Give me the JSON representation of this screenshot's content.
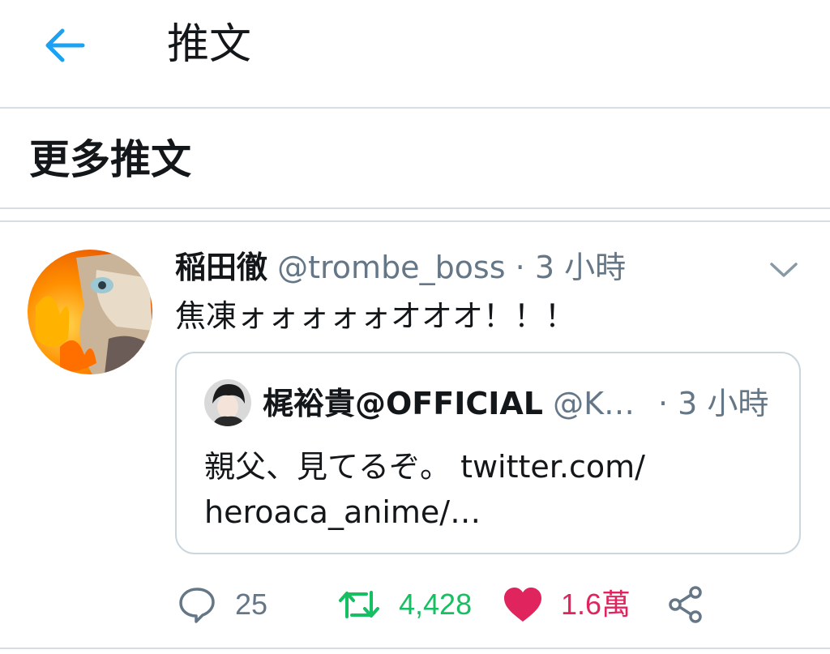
{
  "header": {
    "title": "推文",
    "back_icon": "arrow-left-icon",
    "accent_color": "#1da1f2"
  },
  "section": {
    "title": "更多推文"
  },
  "tweet": {
    "display_name": "稲田徹",
    "handle": "@trombe_boss",
    "separator": "·",
    "time": "3 小時",
    "text": "焦凍ォォォォォオオオ！！！",
    "menu_icon": "chevron-down-icon",
    "quote": {
      "display_name": "梶裕貴@OFFICIAL",
      "handle": "@K…",
      "time": "· 3 小時",
      "text_line1": "親父、見てるぞ。 twitter.com/",
      "text_line2": "heroaca_anime/…"
    },
    "actions": {
      "reply_count": "25",
      "retweet_count": "4,428",
      "like_count": "1.6萬",
      "reply_icon": "reply-bubble-icon",
      "retweet_icon": "retweet-icon",
      "like_icon": "heart-icon",
      "share_icon": "share-icon",
      "retweet_color": "#17bf63",
      "like_color": "#e0245e"
    }
  }
}
